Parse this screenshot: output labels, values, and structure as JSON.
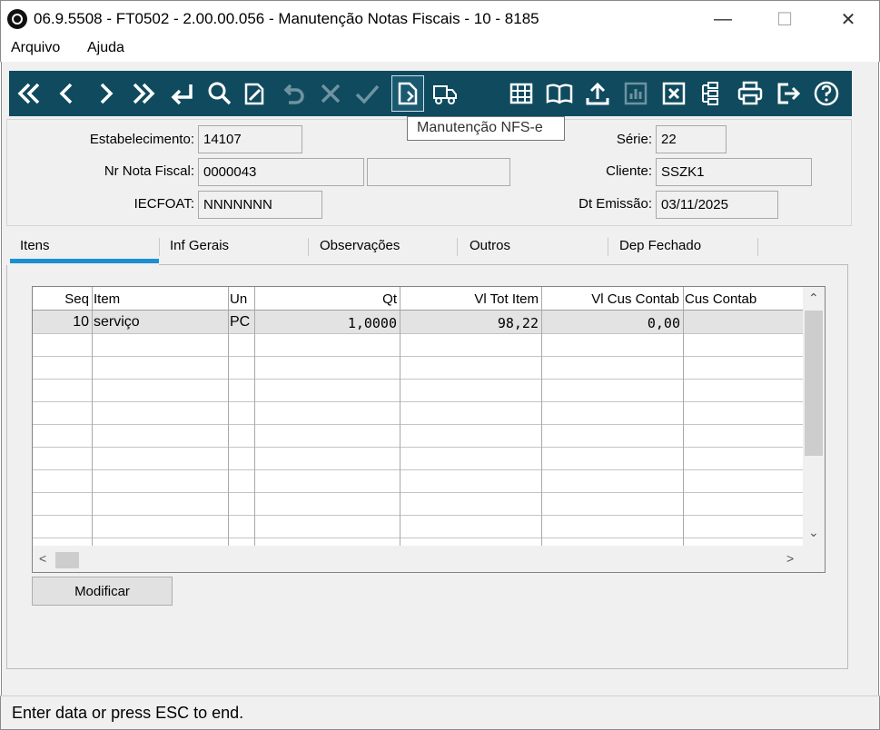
{
  "window": {
    "title": "06.9.5508 - FT0502 - 2.00.00.056 - Manutenção Notas Fiscais - 10 - 8185",
    "minimize": "—",
    "maximize": "☐",
    "close": "✕"
  },
  "menu": [
    "Arquivo",
    "Ajuda"
  ],
  "toolbar": {
    "buttons": [
      "first-icon",
      "previous-icon",
      "next-icon",
      "last-icon",
      "goto-icon",
      "search-icon",
      "edit-icon",
      "undo-icon",
      "cancel-icon",
      "confirm-icon",
      "nfse-icon",
      "delivery-truck-icon",
      "grid-icon",
      "book-icon",
      "upload-icon",
      "chart-icon",
      "close-box-icon",
      "tree-icon",
      "print-icon",
      "exit-icon",
      "help-icon"
    ],
    "tooltip": "Manutenção NFS-e",
    "color": "#0f4a5e"
  },
  "header": {
    "estabelecimento_label": "Estabelecimento:",
    "estabelecimento": "14107",
    "nr_nota_label": "Nr Nota Fiscal:",
    "nr_nota": "0000043",
    "iecfoat_label": "IECFOAT:",
    "iecfoat": "NNNNNNN",
    "serie_label": "Série:",
    "serie": "22",
    "cliente_label": "Cliente:",
    "cliente": "SSZK1",
    "dt_emissao_label": "Dt Emissão:",
    "dt_emissao": "03/11/2025"
  },
  "tabs": [
    "Itens",
    "Inf Gerais",
    "Observações",
    "Outros",
    "Dep Fechado"
  ],
  "grid": {
    "columns": [
      "Seq",
      "Item",
      "Un",
      "Qt",
      "Vl Tot Item",
      "Vl Cus Contab",
      "Cus Contab"
    ],
    "rows": [
      {
        "seq": "10",
        "item": "serviço",
        "un": "PC",
        "qt": "1,0000",
        "vl_tot": "98,22",
        "vl_cus": "0,00",
        "cus": ""
      }
    ]
  },
  "actions": {
    "modify": "Modificar"
  },
  "status": "Enter data or press ESC to end."
}
